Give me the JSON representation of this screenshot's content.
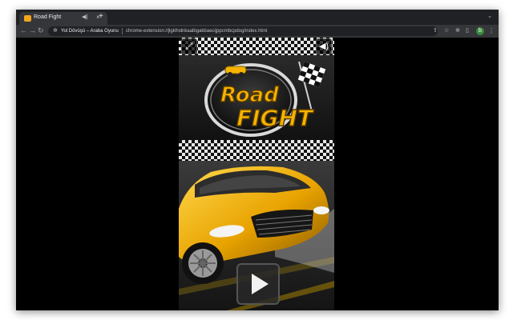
{
  "browser": {
    "tab": {
      "title": "Road Fight",
      "favicon": "car-favicon",
      "audio_icon": "speaker-icon",
      "close_icon": "close-icon"
    },
    "new_tab_icon": "plus-icon",
    "toolbar": {
      "extension_name": "Yol Dövüşü – Araba Oyunu",
      "url": "chrome-extension://jlgkfndnkaalbgakbaecijppcmbcpdog/index.html",
      "profile_initial": "b"
    }
  },
  "game": {
    "title_line1": "Road",
    "title_line2": "FIGHT",
    "fullscreen_icon": "expand-icon",
    "sound_icon": "speaker-icon",
    "play_icon": "play-icon"
  },
  "colors": {
    "accent": "#f5b400",
    "chrome_dark": "#202124",
    "chrome_toolbar": "#35363a"
  }
}
